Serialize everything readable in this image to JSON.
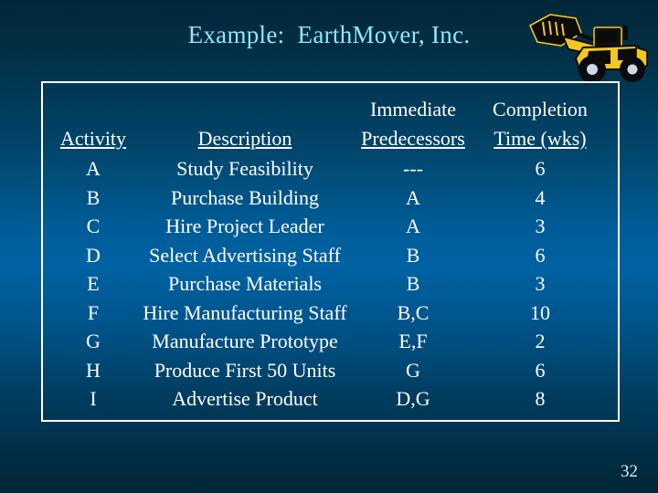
{
  "slide": {
    "title": "Example:  EarthMover, Inc.",
    "page_number": "32",
    "clipart_name": "wheel-loader-clipart",
    "colors": {
      "title": "#8fe9f2",
      "text": "#ffffff",
      "border": "#ffffff",
      "background_top": "#01263a",
      "background_mid": "#0062a3",
      "background_bottom": "#012534",
      "clipart_body": "#0a0a0a",
      "clipart_accent": "#f2c81e"
    }
  },
  "table": {
    "headers": [
      {
        "line1": "",
        "line2": "Activity"
      },
      {
        "line1": "",
        "line2": "Description"
      },
      {
        "line1": "Immediate",
        "line2": "Predecessors"
      },
      {
        "line1": "Completion",
        "line2": "Time (wks)"
      }
    ],
    "rows": [
      {
        "activity": "A",
        "description": "Study Feasibility",
        "predecessors": "---",
        "time": "6"
      },
      {
        "activity": "B",
        "description": "Purchase Building",
        "predecessors": "A",
        "time": "4"
      },
      {
        "activity": "C",
        "description": "Hire Project Leader",
        "predecessors": "A",
        "time": "3"
      },
      {
        "activity": "D",
        "description": "Select Advertising Staff",
        "predecessors": "B",
        "time": "6"
      },
      {
        "activity": "E",
        "description": "Purchase Materials",
        "predecessors": "B",
        "time": "3"
      },
      {
        "activity": "F",
        "description": "Hire Manufacturing Staff",
        "predecessors": "B,C",
        "time": "10"
      },
      {
        "activity": "G",
        "description": "Manufacture Prototype",
        "predecessors": "E,F",
        "time": "2"
      },
      {
        "activity": "H",
        "description": "Produce First 50 Units",
        "predecessors": "G",
        "time": "6"
      },
      {
        "activity": "I",
        "description": "Advertise Product",
        "predecessors": "D,G",
        "time": "8"
      }
    ]
  }
}
